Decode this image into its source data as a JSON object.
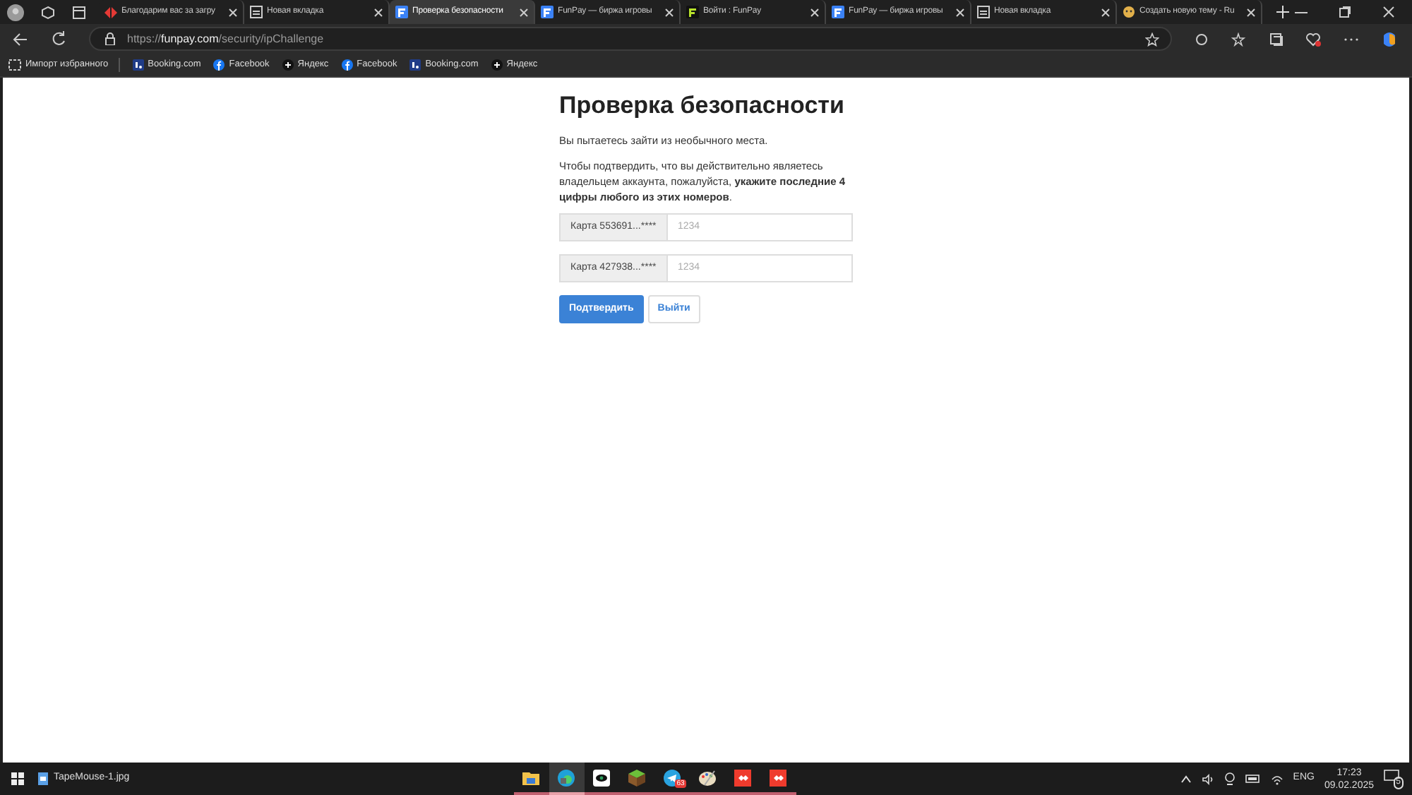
{
  "browser": {
    "tabs": [
      {
        "title": "Благодарим вас за загру",
        "kind": "red",
        "selected": false
      },
      {
        "title": "Новая вкладка",
        "kind": "page",
        "selected": false
      },
      {
        "title": "Проверка безопасности",
        "kind": "fblue",
        "selected": true
      },
      {
        "title": "FunPay — биржа игровы",
        "kind": "fblue",
        "selected": false
      },
      {
        "title": "Войти : FunPay",
        "kind": "fdark",
        "selected": false
      },
      {
        "title": "FunPay — биржа игровы",
        "kind": "fblue",
        "selected": false
      },
      {
        "title": "Новая вкладка",
        "kind": "page",
        "selected": false
      },
      {
        "title": "Создать новую тему - Ru",
        "kind": "emoji",
        "selected": false
      }
    ],
    "url": {
      "scheme": "https://",
      "domain": "funpay.com",
      "path": "/security/ipChallenge"
    },
    "bookmarks": [
      {
        "label": "Импорт избранного",
        "kind": "import"
      },
      {
        "label": "Booking.com",
        "kind": "booking"
      },
      {
        "label": "Facebook",
        "kind": "facebook"
      },
      {
        "label": "Яндекс",
        "kind": "plus"
      },
      {
        "label": "Facebook",
        "kind": "facebook"
      },
      {
        "label": "Booking.com",
        "kind": "booking"
      },
      {
        "label": "Яндекс",
        "kind": "plus"
      }
    ]
  },
  "page": {
    "title": "Проверка безопасности",
    "intro": "Вы пытаетесь зайти из необычного места.",
    "instruction": "Чтобы подтвердить, что вы действительно являетесь владельцем аккаунта, пожалуйста, **укажите последние 4 цифры любого из этих номеров**.",
    "cards": [
      {
        "label": "Карта 553691...****",
        "placeholder": "1234"
      },
      {
        "label": "Карта 427938...****",
        "placeholder": "1234"
      }
    ],
    "buttons": [
      {
        "label": "Подтвердить",
        "kind": "primary"
      },
      {
        "label": "Выйти",
        "kind": "secondary"
      }
    ]
  },
  "taskbar": {
    "file": "TapeMouse-1.jpg",
    "apps": [
      {
        "kind": "folder",
        "selected": false
      },
      {
        "kind": "edge",
        "selected": true
      },
      {
        "kind": "eye",
        "selected": false
      },
      {
        "kind": "cube",
        "selected": false
      },
      {
        "kind": "telegram",
        "selected": false,
        "badge": "63"
      },
      {
        "kind": "palette",
        "selected": false
      },
      {
        "kind": "anydesk",
        "selected": false
      },
      {
        "kind": "anydesk",
        "selected": false
      }
    ],
    "language": "ENG",
    "time": "17:23",
    "date": "09.02.2025",
    "notifications": "5"
  }
}
